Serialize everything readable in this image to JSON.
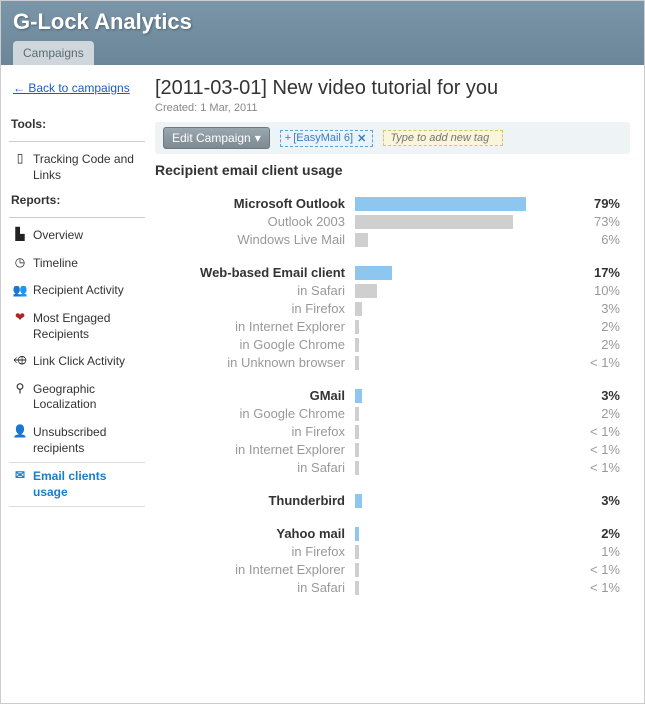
{
  "app_title": "G-Lock Analytics",
  "top_tab": "Campaigns",
  "back_link": "← Back to campaigns",
  "sidebar": {
    "tools_label": "Tools:",
    "reports_label": "Reports:",
    "tools": [
      {
        "icon": "page-icon",
        "label": "Tracking Code and Links"
      }
    ],
    "reports": [
      {
        "icon": "bars-icon",
        "label": "Overview"
      },
      {
        "icon": "clock-icon",
        "label": "Timeline"
      },
      {
        "icon": "people-icon",
        "label": "Recipient Activity"
      },
      {
        "icon": "heart-icon",
        "label": "Most Engaged Recipients"
      },
      {
        "icon": "link-icon",
        "label": "Link Click Activity"
      },
      {
        "icon": "pin-icon",
        "label": "Geographic Localization"
      },
      {
        "icon": "person-x-icon",
        "label": "Unsubscribed recipients"
      },
      {
        "icon": "mail-icon",
        "label": "Email clients usage",
        "active": true
      }
    ]
  },
  "page": {
    "title": "[2011-03-01] New video tutorial for you",
    "created_label": "Created: 1 Mar, 2011",
    "edit_button": "Edit Campaign",
    "tag": "[EasyMail 6]",
    "tag_input_placeholder": "Type to add new tag",
    "section_title": "Recipient email client usage"
  },
  "chart_data": {
    "type": "bar",
    "xlabel": "",
    "ylabel": "percent",
    "xlim": [
      0,
      100
    ],
    "groups": [
      {
        "name": "Microsoft Outlook",
        "value": 79,
        "subs": [
          {
            "name": "Outlook 2003",
            "value": 73
          },
          {
            "name": "Windows Live Mail",
            "value": 6
          }
        ]
      },
      {
        "name": "Web-based Email client",
        "value": 17,
        "subs": [
          {
            "name": "in Safari",
            "value": 10
          },
          {
            "name": "in Firefox",
            "value": 3
          },
          {
            "name": "in Internet Explorer",
            "value": 2
          },
          {
            "name": "in Google Chrome",
            "value": 2
          },
          {
            "name": "in Unknown browser",
            "value": 0.5
          }
        ]
      },
      {
        "name": "GMail",
        "value": 3,
        "subs": [
          {
            "name": "in Google Chrome",
            "value": 2
          },
          {
            "name": "in Firefox",
            "value": 0.5
          },
          {
            "name": "in Internet Explorer",
            "value": 0.5
          },
          {
            "name": "in Safari",
            "value": 0.5
          }
        ]
      },
      {
        "name": "Thunderbird",
        "value": 3,
        "subs": []
      },
      {
        "name": "Yahoo mail",
        "value": 2,
        "subs": [
          {
            "name": "in Firefox",
            "value": 1
          },
          {
            "name": "in Internet Explorer",
            "value": 0.5
          },
          {
            "name": "in Safari",
            "value": 0.5
          }
        ]
      }
    ]
  }
}
